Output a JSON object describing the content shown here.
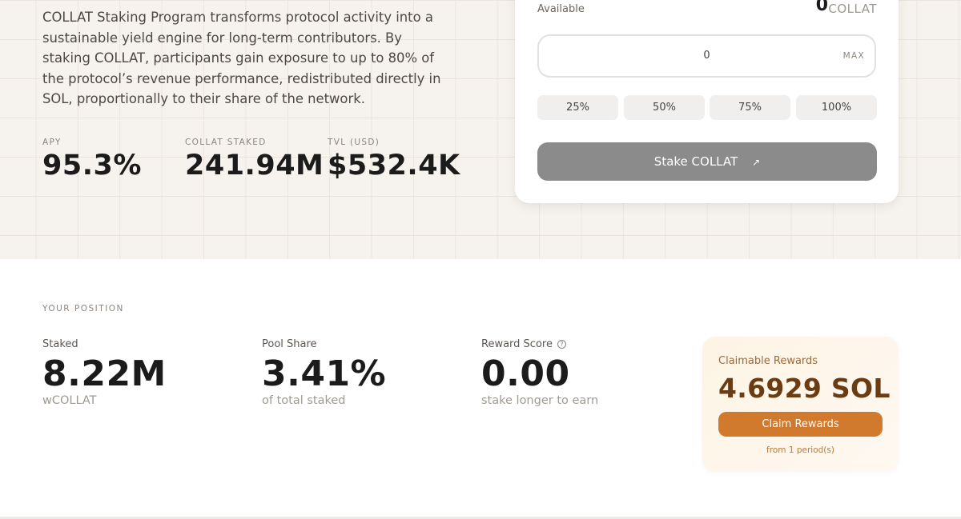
{
  "intro": {
    "text": "COLLAT Staking Program transforms protocol activity into a sustainable yield engine for long-term contributors. By staking COLLAT, participants gain exposure to up to 80% of the protocol’s revenue performance, redistributed directly in SOL, proportionally to their share of the network."
  },
  "stats": [
    {
      "label": "APY",
      "value": "95.3%"
    },
    {
      "label": "COLLAT STAKED",
      "value": "241.94M"
    },
    {
      "label": "TVL (USD)",
      "value": "$532.4K"
    }
  ],
  "stake_card": {
    "available_label": "Available",
    "available_value": "0",
    "available_unit": "COLLAT",
    "amount_value": "0",
    "max_label": "MAX",
    "percent_buttons": [
      "25%",
      "50%",
      "75%",
      "100%"
    ],
    "stake_button_label": "Stake COLLAT",
    "stake_button_icon": "arrow-up-right-icon"
  },
  "position": {
    "section_label": "YOUR POSITION",
    "staked": {
      "label": "Staked",
      "value": "8.22M",
      "sub": "wCOLLAT"
    },
    "pool_share": {
      "label": "Pool Share",
      "value": "3.41%",
      "sub": "of total staked"
    },
    "reward_score": {
      "label": "Reward Score",
      "value": "0.00",
      "sub": "stake longer to earn",
      "help_icon": "?"
    }
  },
  "rewards": {
    "label": "Claimable Rewards",
    "value": "4.6929 SOL",
    "claim_button_label": "Claim Rewards",
    "footnote": "from 1 period(s)"
  },
  "colors": {
    "accent": "#d17a2d",
    "rewards_text": "#6b3b12",
    "stake_button_disabled": "#8b8b8b"
  }
}
